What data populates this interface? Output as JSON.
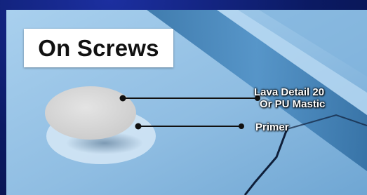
{
  "title": "On Screws",
  "callouts": [
    {
      "lines": [
        "Lava Detail 20",
        "Or PU Mastic"
      ]
    },
    {
      "lines": [
        "Primer"
      ]
    }
  ],
  "colors": {
    "background": "#0b1a63",
    "surface": "#9fc7e6",
    "surface_dark": "#3f7fb3",
    "cap": "#d9d9d9",
    "primer": "#cfe3f3",
    "leader_line": "#111111",
    "label_text": "#ffffff"
  }
}
